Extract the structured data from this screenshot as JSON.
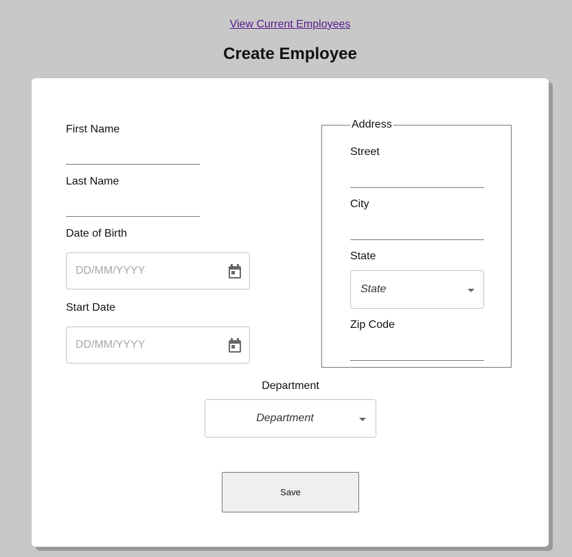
{
  "nav": {
    "employees_link": "View Current Employees"
  },
  "page": {
    "title": "Create Employee"
  },
  "form": {
    "first_name": {
      "label": "First Name",
      "value": ""
    },
    "last_name": {
      "label": "Last Name",
      "value": ""
    },
    "date_of_birth": {
      "label": "Date of Birth",
      "placeholder": "DD/MM/YYYY",
      "icon": "calendar-icon"
    },
    "start_date": {
      "label": "Start Date",
      "placeholder": "DD/MM/YYYY",
      "icon": "calendar-icon"
    },
    "address": {
      "legend": "Address",
      "street": {
        "label": "Street",
        "value": ""
      },
      "city": {
        "label": "City",
        "value": ""
      },
      "state": {
        "label": "State",
        "selected": "State",
        "icon": "caret-down-icon"
      },
      "zip": {
        "label": "Zip Code",
        "value": ""
      }
    },
    "department": {
      "label": "Department",
      "selected": "Department",
      "icon": "caret-down-icon"
    },
    "save_label": "Save"
  },
  "colors": {
    "background": "#c8c8c8",
    "card": "#ffffff",
    "link": "#551a8b",
    "button": "#efefef"
  }
}
